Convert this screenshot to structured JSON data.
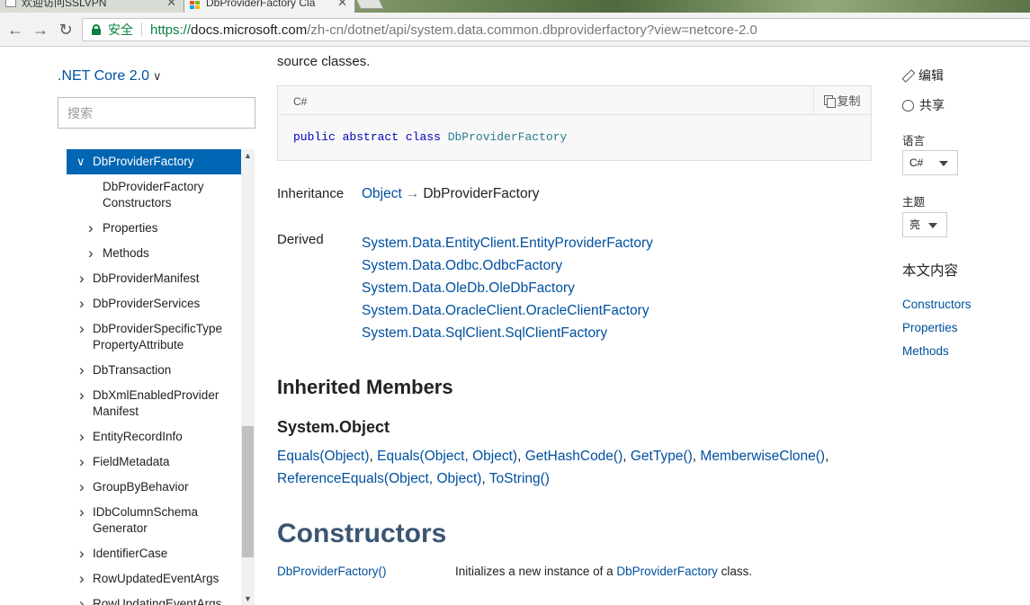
{
  "browser": {
    "tabs": [
      {
        "title": "欢迎访问SSLVPN",
        "active": false
      },
      {
        "title": "DbProviderFactory Cla",
        "active": true
      }
    ],
    "secure_label": "安全",
    "url_scheme": "https://",
    "url_host": "docs.microsoft.com",
    "url_rest": "/zh-cn/dotnet/api/system.data.common.dbproviderfactory?view=netcore-2.0"
  },
  "toc": {
    "version": ".NET Core 2.0",
    "search_placeholder": "搜索",
    "items": [
      {
        "label": "DbProviderFactory",
        "selected": true,
        "expanded": true
      },
      {
        "label": "DbProviderFactory Constructors",
        "lines": [
          "DbProviderFactory",
          "Constructors"
        ],
        "sub": true,
        "leaf": true
      },
      {
        "label": "Properties",
        "sub": true
      },
      {
        "label": "Methods",
        "sub": true
      },
      {
        "label": "DbProviderManifest"
      },
      {
        "label": "DbProviderServices"
      },
      {
        "label": "DbProviderSpecificTypePropertyAttribute",
        "lines": [
          "DbProviderSpecificType",
          "PropertyAttribute"
        ]
      },
      {
        "label": "DbTransaction"
      },
      {
        "label": "DbXmlEnabledProviderManifest",
        "lines": [
          "DbXmlEnabledProvider",
          "Manifest"
        ]
      },
      {
        "label": "EntityRecordInfo"
      },
      {
        "label": "FieldMetadata"
      },
      {
        "label": "GroupByBehavior"
      },
      {
        "label": "IDbColumnSchemaGenerator",
        "lines": [
          "IDbColumnSchema",
          "Generator"
        ]
      },
      {
        "label": "IdentifierCase"
      },
      {
        "label": "RowUpdatedEventArgs"
      },
      {
        "label": "RowUpdatingEventArgs"
      }
    ]
  },
  "main": {
    "intro": "source classes.",
    "code": {
      "lang": "C#",
      "copy_label": "复制",
      "kw1": "public",
      "kw2": "abstract",
      "kw3": "class",
      "type": "DbProviderFactory"
    },
    "inheritance_label": "Inheritance",
    "inheritance_base": "Object",
    "inheritance_arrow": "→",
    "inheritance_self": "DbProviderFactory",
    "derived_label": "Derived",
    "derived": [
      "System.Data.EntityClient.EntityProviderFactory",
      "System.Data.Odbc.OdbcFactory",
      "System.Data.OleDb.OleDbFactory",
      "System.Data.OracleClient.OracleClientFactory",
      "System.Data.SqlClient.SqlClientFactory"
    ],
    "inherited_members_heading": "Inherited Members",
    "object_heading": "System.Object",
    "members": [
      "Equals(Object)",
      "Equals(Object, Object)",
      "GetHashCode()",
      "GetType()",
      "MemberwiseClone()",
      "ReferenceEquals(Object, Object)",
      "ToString()"
    ],
    "constructors_heading": "Constructors",
    "ctor_name": "DbProviderFactory()",
    "ctor_desc_prefix": "Initializes a new instance of a ",
    "ctor_desc_link": "DbProviderFactory",
    "ctor_desc_suffix": " class."
  },
  "rail": {
    "edit": "编辑",
    "share": "共享",
    "language_label": "语言",
    "language_value": "C#",
    "theme_label": "主题",
    "theme_value": "亮",
    "in_this_article": "本文内容",
    "links": [
      "Constructors",
      "Properties",
      "Methods"
    ]
  }
}
